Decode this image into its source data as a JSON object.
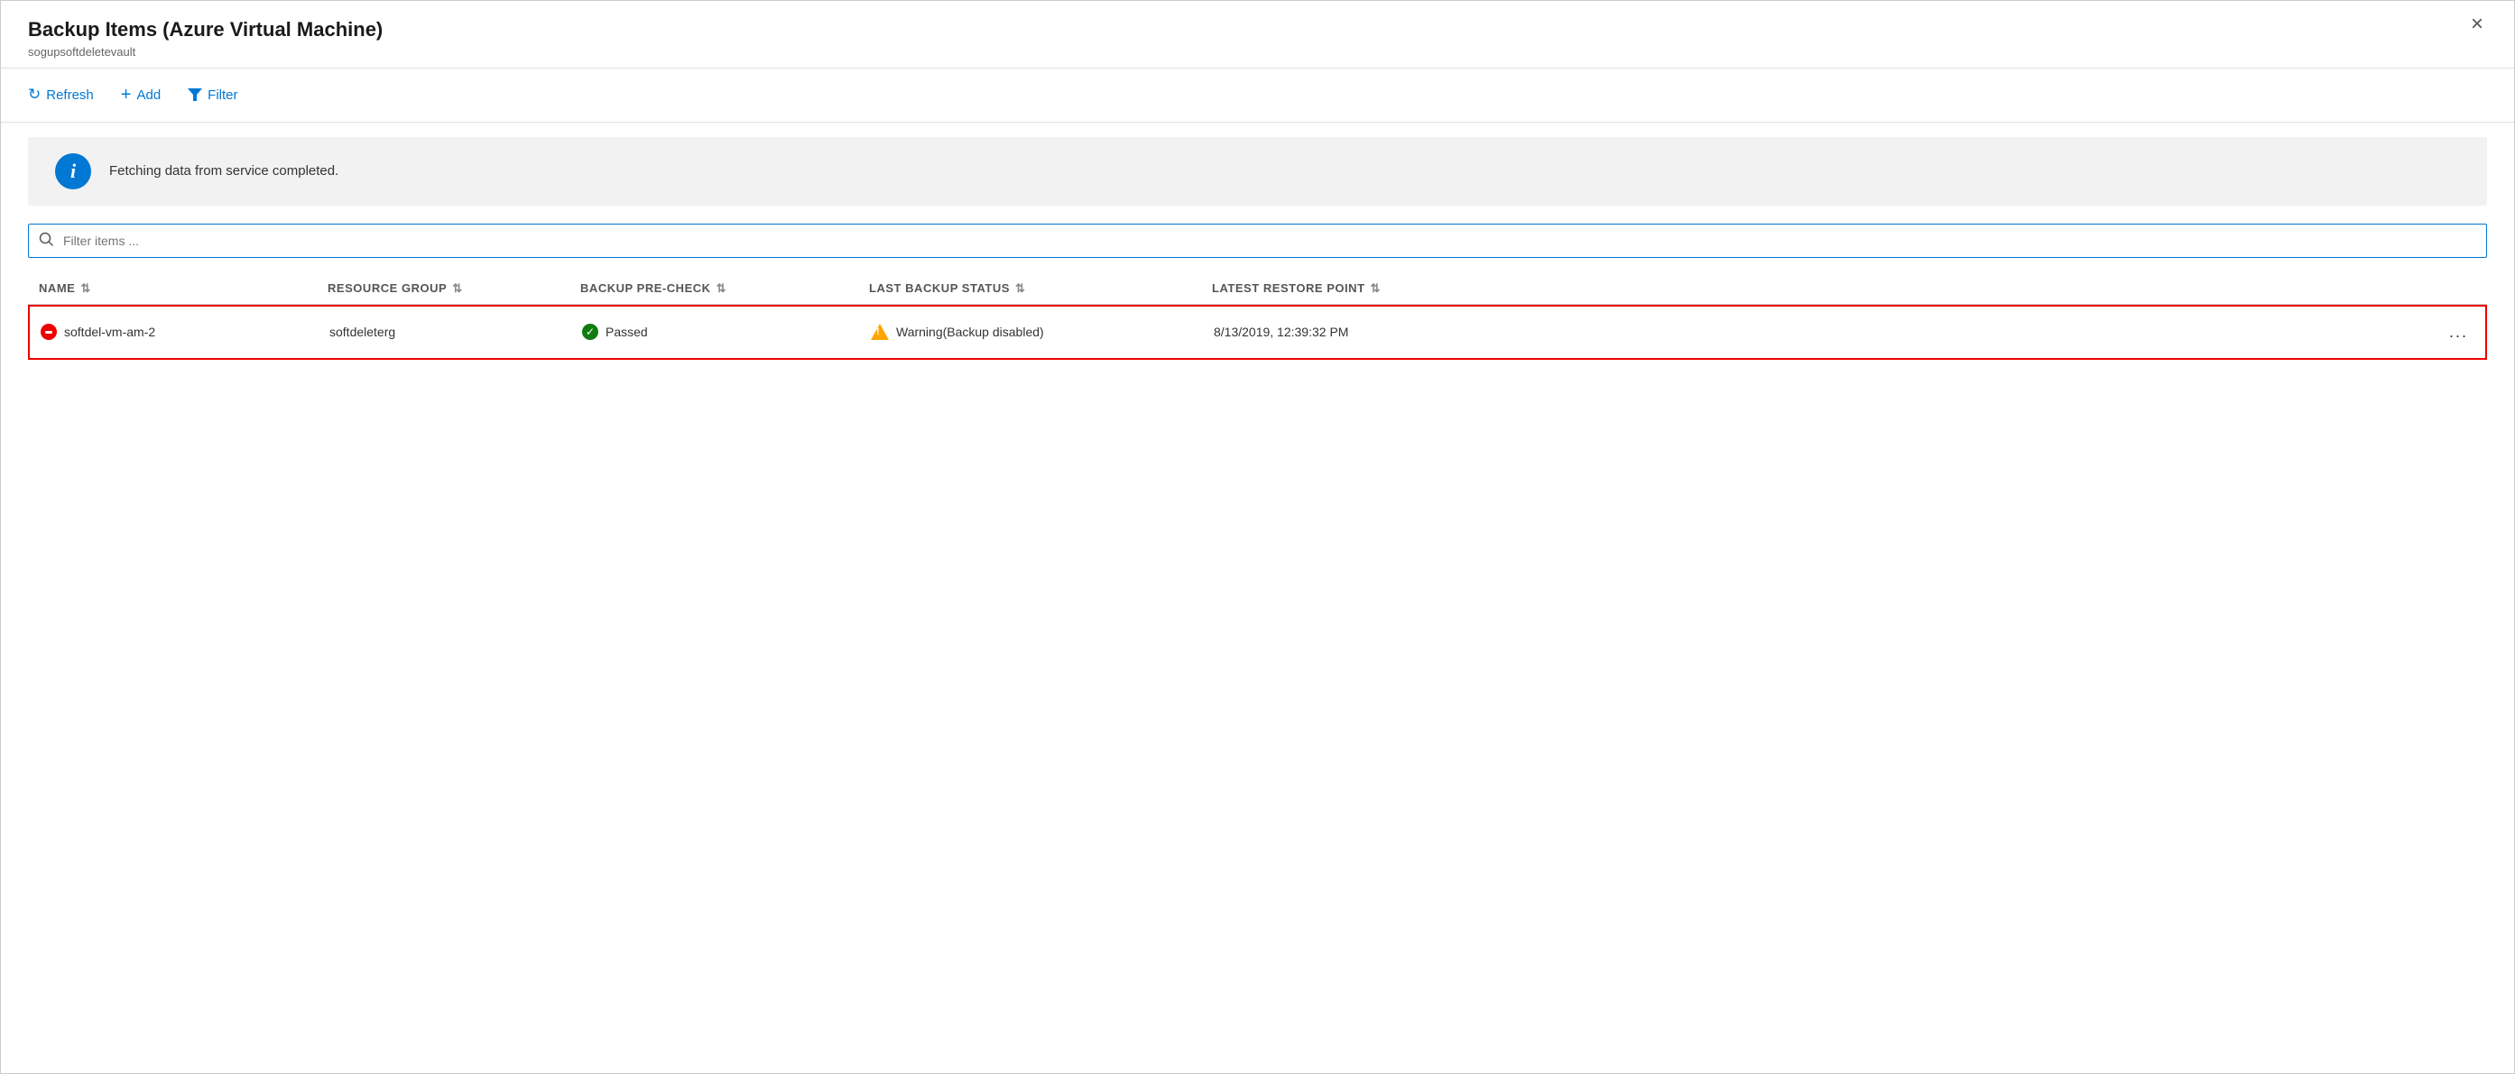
{
  "window": {
    "title": "Backup Items (Azure Virtual Machine)",
    "subtitle": "sogupsoftdeletevault",
    "close_label": "×"
  },
  "toolbar": {
    "refresh_label": "Refresh",
    "add_label": "Add",
    "filter_label": "Filter"
  },
  "banner": {
    "message": "Fetching data from service completed."
  },
  "search": {
    "placeholder": "Filter items ..."
  },
  "table": {
    "columns": [
      {
        "id": "name",
        "label": "NAME"
      },
      {
        "id": "resource_group",
        "label": "RESOURCE GROUP"
      },
      {
        "id": "backup_pre_check",
        "label": "BACKUP PRE-CHECK"
      },
      {
        "id": "last_backup_status",
        "label": "LAST BACKUP STATUS"
      },
      {
        "id": "latest_restore_point",
        "label": "LATEST RESTORE POINT"
      }
    ],
    "rows": [
      {
        "name": "softdel-vm-am-2",
        "resource_group": "softdeleterg",
        "backup_pre_check": "Passed",
        "last_backup_status": "Warning(Backup disabled)",
        "latest_restore_point": "8/13/2019, 12:39:32 PM",
        "highlighted": true
      }
    ]
  },
  "icons": {
    "refresh": "↻",
    "add": "+",
    "filter": "▾",
    "search": "🔍",
    "sort": "⇅",
    "more": "..."
  }
}
